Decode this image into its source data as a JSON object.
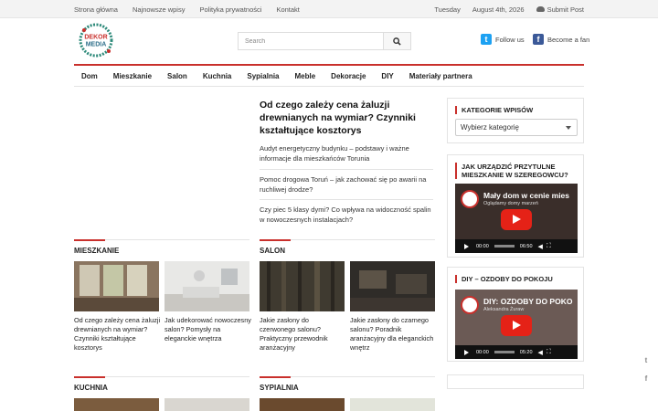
{
  "topbar": {
    "links": [
      "Strona główna",
      "Najnowsze wpisy",
      "Polityka prywatności",
      "Kontakt"
    ],
    "day": "Tuesday",
    "date": "August 4th, 2026",
    "submit": "Submit Post"
  },
  "logo": {
    "line1": "DEKOR",
    "line2": "MEDIA"
  },
  "search": {
    "placeholder": "Search"
  },
  "social": {
    "twitter": "Follow us",
    "facebook": "Become a fan"
  },
  "nav": [
    "Dom",
    "Mieszkanie",
    "Salon",
    "Kuchnia",
    "Sypialnia",
    "Meble",
    "Dekoracje",
    "DIY",
    "Materiały partnera"
  ],
  "featured": {
    "title": "Od czego zależy cena żaluzji drewnianych na wymiar? Czynniki kształtujące kosztorys",
    "related": [
      "Audyt energetyczny budynku – podstawy i ważne informacje dla mieszkańców Torunia",
      "Pomoc drogowa Toruń – jak zachować się po awarii na ruchliwej drodze?",
      "Czy piec 5 klasy dymi? Co wpływa na widoczność spalin w nowoczesnych instalacjach?"
    ]
  },
  "sections": {
    "mieszkanie": {
      "title": "MIESZKANIE",
      "items": [
        "Od czego zależy cena żaluzji drewnianych na wymiar? Czynniki kształtujące kosztorys",
        "Jak udekorować nowoczesny salon? Pomysły na eleganckie wnętrza"
      ]
    },
    "salon": {
      "title": "SALON",
      "items": [
        "Jakie zasłony do czerwonego salonu? Praktyczny przewodnik aranżacyjny",
        "Jakie zasłony do czarnego salonu? Poradnik aranżacyjny dla eleganckich wnętrz"
      ]
    },
    "kuchnia": {
      "title": "KUCHNIA"
    },
    "sypialnia": {
      "title": "SYPIALNIA"
    }
  },
  "sidebar": {
    "categories": {
      "title": "KATEGORIE WPISÓW",
      "select": "Wybierz kategorię"
    },
    "video1": {
      "title": "JAK URZĄDZIĆ PRZYTULNE MIESZKANIE W SZEREGOWCU?",
      "video_title": "Mały dom w cenie mies",
      "video_sub": "Oglądamy domy marzeń",
      "current": "00:00",
      "duration": "06:50"
    },
    "video2": {
      "title": "DIY – OZDOBY DO POKOJU",
      "video_title": "DIY: OZDOBY DO POKO",
      "video_sub": "Aleksandra Żuraw",
      "current": "00:00",
      "duration": "05:20"
    }
  },
  "fixed_social": {
    "twitter_icon": "twitter-icon",
    "facebook_icon": "facebook-icon"
  },
  "colors": {
    "accent": "#c9302c",
    "twitter": "#1da1f2",
    "facebook": "#3b5998",
    "youtube": "#e52217"
  }
}
